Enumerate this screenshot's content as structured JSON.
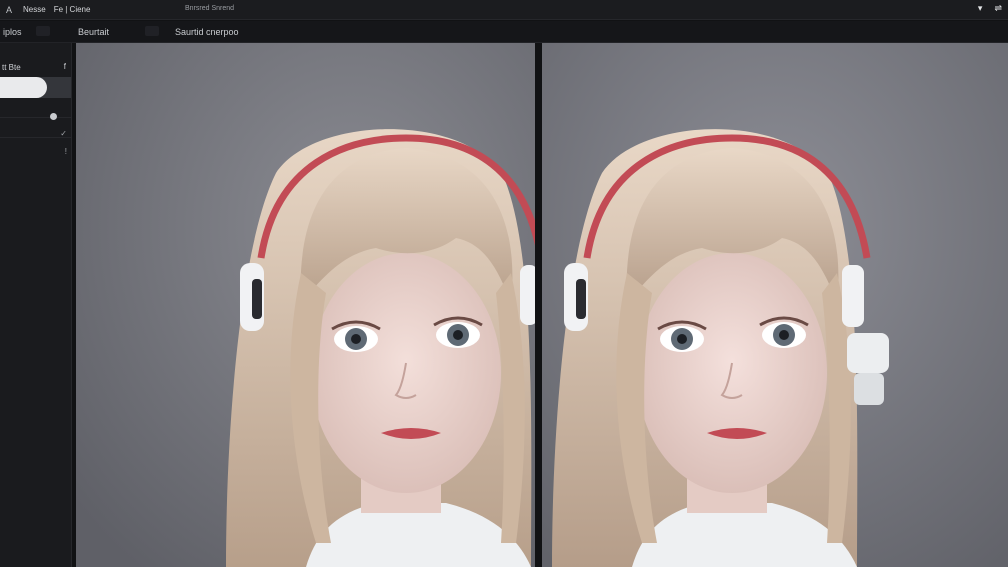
{
  "menubar": {
    "app_icon": "A",
    "items": [
      "Nesse",
      "Fe | Ciene"
    ],
    "title": "Bnrsred Snrend",
    "right_icons": [
      "wifi-icon",
      "share-icon"
    ]
  },
  "toolbar": {
    "item1": "iplos",
    "item2": "Beurtait",
    "item3": "Saurtid cnerpoo"
  },
  "sidebar": {
    "label": "tt Bte",
    "f_glyph": "f",
    "slider_value": 0.66,
    "slider_text": "·",
    "glyph_a": "✓",
    "glyph_b": "!"
  },
  "viewports": {
    "left_name": "portrait-original",
    "right_name": "portrait-rendered"
  },
  "colors": {
    "background": "#111214",
    "panel": "#1a1b1e",
    "viewport": "#6c6d74",
    "hair": "#d8c3ad",
    "headband": "#c24b55"
  }
}
